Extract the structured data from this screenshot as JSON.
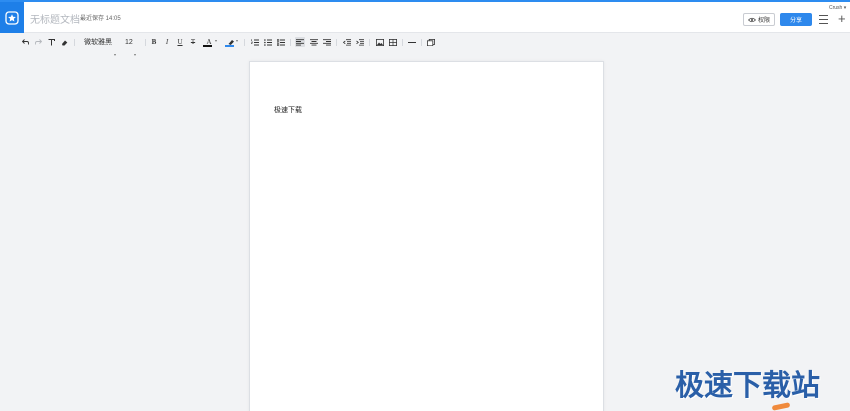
{
  "header": {
    "title": "无标题文档",
    "save_status": "最近保存 14:05",
    "permission_label": "权限",
    "share_label": "分享",
    "user": "Crush",
    "plus": "+"
  },
  "toolbar": {
    "font_family": "微软雅黑",
    "font_size": "12",
    "bold": "B",
    "italic": "I",
    "underline": "U",
    "strike": "T",
    "font_color": "A",
    "highlight": "A"
  },
  "document": {
    "body": "极速下载"
  },
  "watermark": {
    "text": "极速下载站"
  },
  "colors": {
    "accent": "#2e88ec",
    "logo_bg": "#1e7fe8",
    "watermark": "#2a5fa8"
  }
}
